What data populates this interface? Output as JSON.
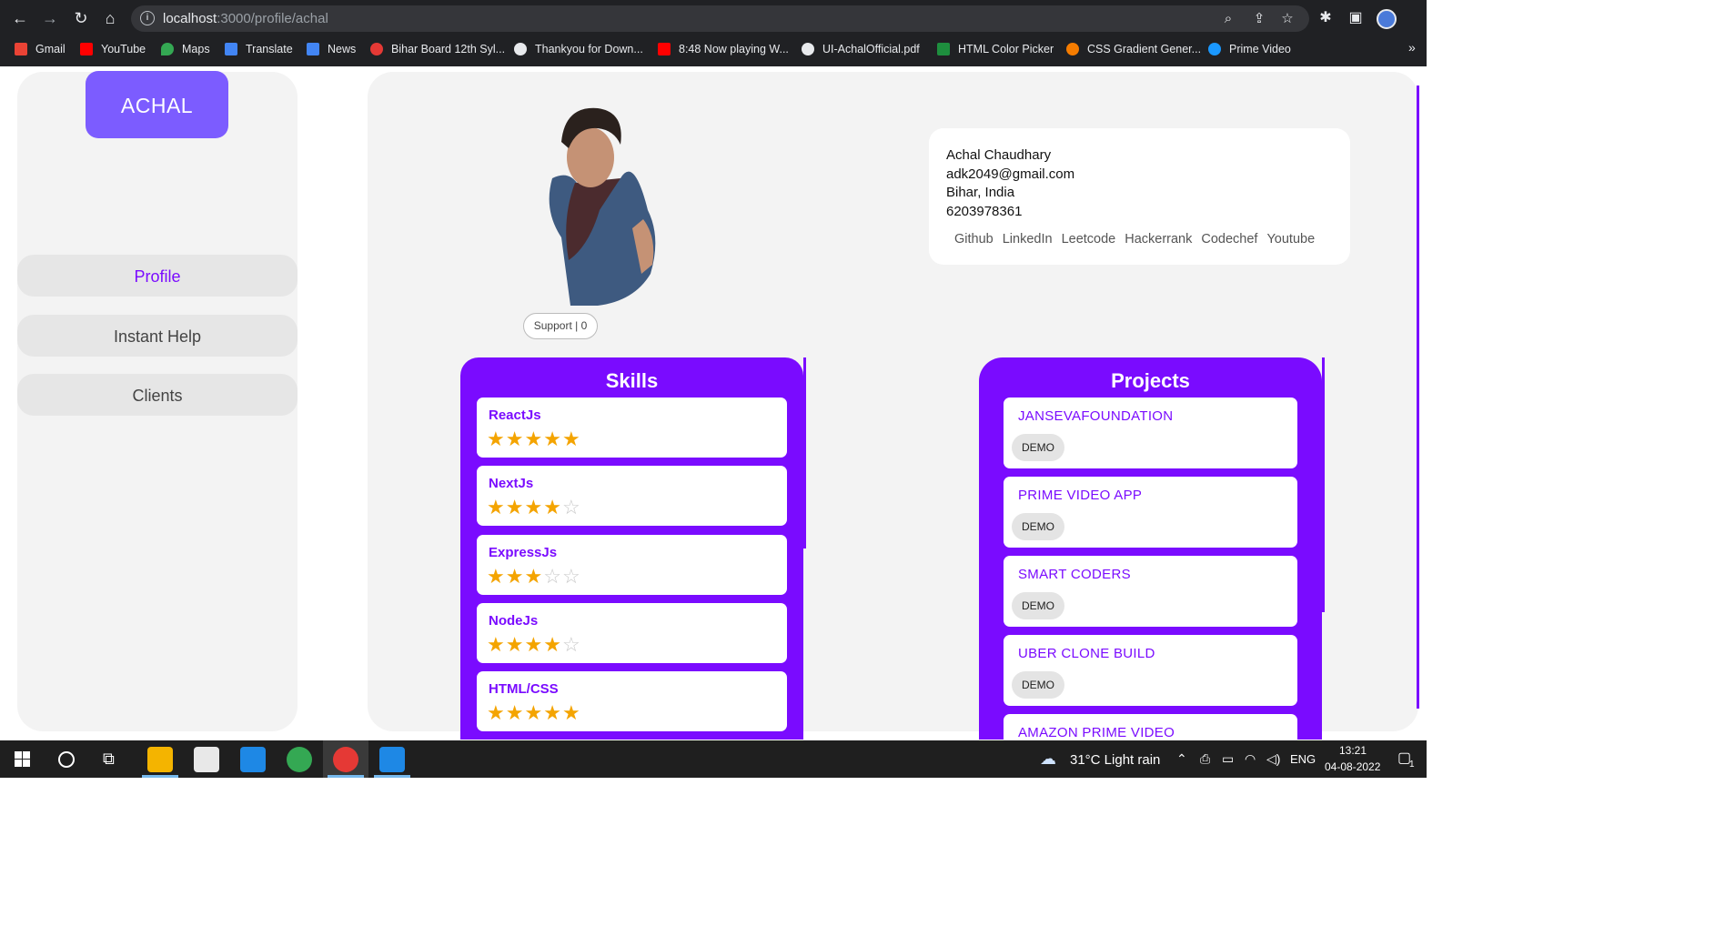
{
  "browser": {
    "url_host": "localhost",
    "url_rest": ":3000/profile/achal",
    "bookmarks": [
      {
        "label": "Gmail",
        "color": "#ea4335"
      },
      {
        "label": "YouTube",
        "color": "#ff0000"
      },
      {
        "label": "Maps",
        "color": "#34a853"
      },
      {
        "label": "Translate",
        "color": "#4285f4"
      },
      {
        "label": "News",
        "color": "#4285f4"
      },
      {
        "label": "Bihar Board 12th Syl...",
        "color": "#e53935"
      },
      {
        "label": "Thankyou for Down...",
        "color": "#e8eaed"
      },
      {
        "label": "8:48 Now playing W...",
        "color": "#ff0000"
      },
      {
        "label": "UI-AchalOfficial.pdf",
        "color": "#e8eaed"
      },
      {
        "label": "HTML Color Picker",
        "color": "#1e8e3e"
      },
      {
        "label": "CSS Gradient Gener...",
        "color": "#f57c00"
      },
      {
        "label": "Prime Video",
        "color": "#1a98ff"
      }
    ]
  },
  "sidebar": {
    "brand": "ACHAL",
    "items": [
      {
        "label": "Profile",
        "active": true
      },
      {
        "label": "Instant Help",
        "active": false
      },
      {
        "label": "Clients",
        "active": false
      }
    ]
  },
  "profile": {
    "support_label": "Support | 0",
    "name": "Achal Chaudhary",
    "email": "adk2049@gmail.com",
    "location": "Bihar, India",
    "phone": "6203978361",
    "links": [
      "Github",
      "LinkedIn",
      "Leetcode",
      "Hackerrank",
      "Codechef",
      "Youtube"
    ]
  },
  "skills": {
    "title": "Skills",
    "items": [
      {
        "name": "ReactJs",
        "rating": 5,
        "max": 5
      },
      {
        "name": "NextJs",
        "rating": 4,
        "max": 5
      },
      {
        "name": "ExpressJs",
        "rating": 3,
        "max": 5
      },
      {
        "name": "NodeJs",
        "rating": 4,
        "max": 5
      },
      {
        "name": "HTML/CSS",
        "rating": 5,
        "max": 5
      }
    ]
  },
  "projects": {
    "title": "Projects",
    "demo_label": "DEMO",
    "items": [
      "JANSEVAFOUNDATION",
      "PRIME VIDEO APP",
      "SMART CODERS",
      "UBER CLONE BUILD",
      "AMAZON PRIME VIDEO"
    ]
  },
  "taskbar": {
    "weather": "31°C  Light rain",
    "language": "ENG",
    "time": "13:21",
    "date": "04-08-2022",
    "notification_count": "1"
  },
  "colors": {
    "accent": "#7a0bff",
    "brand": "#7c5cff",
    "star": "#f4a400"
  }
}
